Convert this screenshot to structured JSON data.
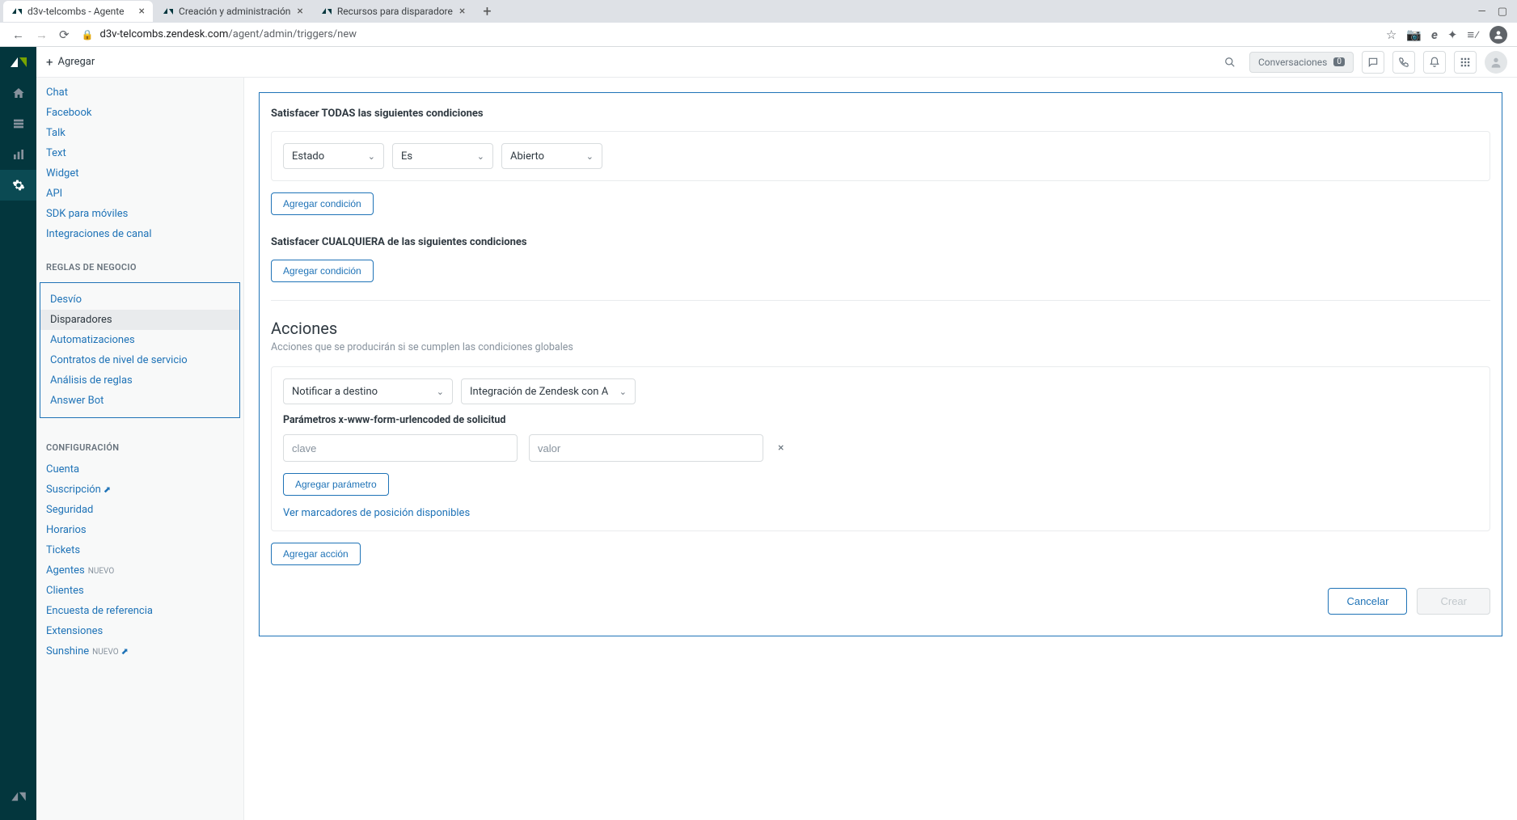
{
  "browser": {
    "tabs": [
      {
        "title": "d3v-telcombs - Agente",
        "active": true
      },
      {
        "title": "Creación y administración",
        "active": false
      },
      {
        "title": "Recursos para disparadore",
        "active": false
      }
    ],
    "url_host": "d3v-telcombs.zendesk.com",
    "url_path": "/agent/admin/triggers/new"
  },
  "topbar": {
    "add_label": "Agregar",
    "conversations_label": "Conversaciones",
    "conversations_count": "0"
  },
  "sidebar": {
    "channels": [
      {
        "label": "Chat"
      },
      {
        "label": "Facebook"
      },
      {
        "label": "Talk"
      },
      {
        "label": "Text"
      },
      {
        "label": "Widget"
      },
      {
        "label": "API"
      },
      {
        "label": "SDK para móviles"
      },
      {
        "label": "Integraciones de canal"
      }
    ],
    "rules_header": "REGLAS DE NEGOCIO",
    "rules": [
      {
        "label": "Desvío",
        "active": false
      },
      {
        "label": "Disparadores",
        "active": true
      },
      {
        "label": "Automatizaciones",
        "active": false
      },
      {
        "label": "Contratos de nivel de servicio",
        "active": false
      },
      {
        "label": "Análisis de reglas",
        "active": false
      },
      {
        "label": "Answer Bot",
        "active": false
      }
    ],
    "config_header": "CONFIGURACIÓN",
    "config": [
      {
        "label": "Cuenta",
        "ext": false
      },
      {
        "label": "Suscripción",
        "ext": true
      },
      {
        "label": "Seguridad",
        "ext": false
      },
      {
        "label": "Horarios",
        "ext": false
      },
      {
        "label": "Tickets",
        "ext": false
      },
      {
        "label": "Agentes",
        "tag": "NUEVO",
        "ext": false
      },
      {
        "label": "Clientes",
        "ext": false
      },
      {
        "label": "Encuesta de referencia",
        "ext": false
      },
      {
        "label": "Extensiones",
        "ext": false
      },
      {
        "label": "Sunshine",
        "tag": "NUEVO",
        "ext": true
      }
    ]
  },
  "form": {
    "all_header": "Satisfacer TODAS las siguientes condiciones",
    "cond_field": "Estado",
    "cond_op": "Es",
    "cond_value": "Abierto",
    "add_condition": "Agregar condición",
    "any_header": "Satisfacer CUALQUIERA de las siguientes condiciones",
    "actions_title": "Acciones",
    "actions_sub": "Acciones que se producirán si se cumplen las condiciones globales",
    "action_type": "Notificar a destino",
    "action_target": "Integración de Zendesk con API de SMS",
    "params_label": "Parámetros x-www-form-urlencoded de solicitud",
    "param_key_placeholder": "clave",
    "param_val_placeholder": "valor",
    "add_param": "Agregar parámetro",
    "view_placeholders": "Ver marcadores de posición disponibles",
    "add_action": "Agregar acción",
    "cancel": "Cancelar",
    "create": "Crear"
  }
}
